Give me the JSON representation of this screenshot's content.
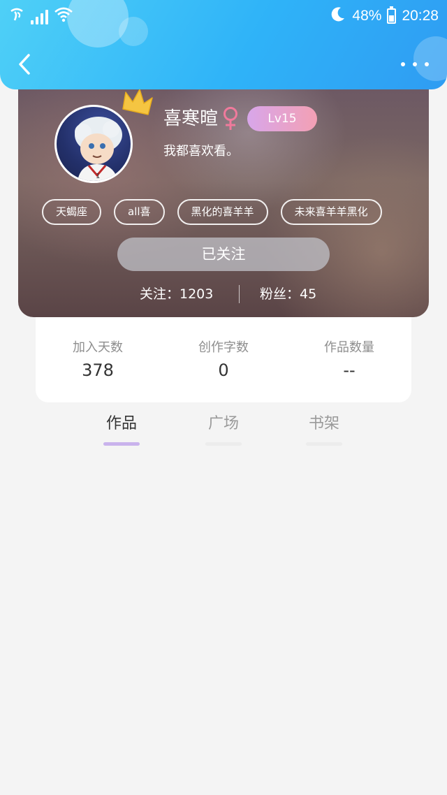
{
  "status_bar": {
    "carrier_icon": "china-telecom-icon",
    "battery": "48%",
    "time": "20:28",
    "battery_level": 0.48
  },
  "profile": {
    "username": "喜寒暄",
    "gender_icon": "female-icon",
    "level": "Lv15",
    "bio": "我都喜欢看。",
    "tags": [
      "天蝎座",
      "all喜",
      "黑化的喜羊羊",
      "未来喜羊羊黑化"
    ],
    "follow_button": "已关注",
    "following": "关注：1203",
    "fans": "粉丝：45"
  },
  "stats": [
    {
      "label": "加入天数",
      "value": "378"
    },
    {
      "label": "创作字数",
      "value": "0"
    },
    {
      "label": "作品数量",
      "value": "--"
    }
  ],
  "tabs": [
    {
      "label": "作品",
      "active": true
    },
    {
      "label": "广场",
      "active": false
    },
    {
      "label": "书架",
      "active": false
    }
  ],
  "colors": {
    "header_start": "#4fd0f7",
    "header_end": "#2f9cf2",
    "level_badge_start": "#d8a6ea",
    "level_badge_end": "#f3a0b4",
    "tab_active_underline": "#c9b3ec",
    "female_symbol": "#f07a9c"
  }
}
